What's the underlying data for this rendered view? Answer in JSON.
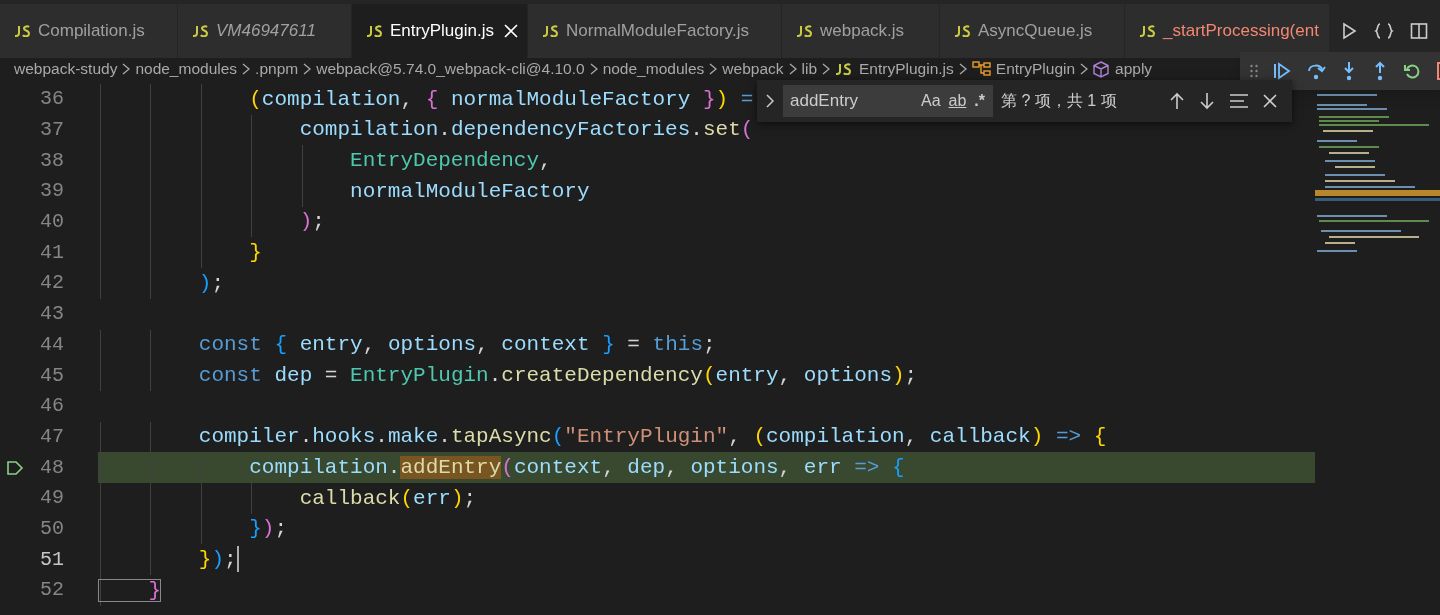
{
  "tabs": [
    {
      "label": "Compilation.js",
      "selected": false,
      "preview": false,
      "error": false
    },
    {
      "label": "VM46947611",
      "selected": false,
      "preview": true,
      "error": false
    },
    {
      "label": "EntryPlugin.js",
      "selected": true,
      "preview": false,
      "error": false
    },
    {
      "label": "NormalModuleFactory.js",
      "selected": false,
      "preview": false,
      "error": false
    },
    {
      "label": "webpack.js",
      "selected": false,
      "preview": false,
      "error": false
    },
    {
      "label": "AsyncQueue.js",
      "selected": false,
      "preview": false,
      "error": false
    },
    {
      "label": "_startProcessing(ent",
      "selected": false,
      "preview": false,
      "error": true
    }
  ],
  "breadcrumbs": [
    {
      "label": "webpack-study",
      "kind": "folder"
    },
    {
      "label": "node_modules",
      "kind": "folder"
    },
    {
      "label": ".pnpm",
      "kind": "folder"
    },
    {
      "label": "webpack@5.74.0_webpack-cli@4.10.0",
      "kind": "folder"
    },
    {
      "label": "node_modules",
      "kind": "folder"
    },
    {
      "label": "webpack",
      "kind": "folder"
    },
    {
      "label": "lib",
      "kind": "folder"
    },
    {
      "label": "EntryPlugin.js",
      "kind": "file"
    },
    {
      "label": "EntryPlugin",
      "kind": "class"
    },
    {
      "label": "apply",
      "kind": "method"
    }
  ],
  "find_widget": {
    "query": "addEntry",
    "options": [
      "Aa",
      "ab",
      ".*"
    ],
    "result": "第 ? 项，共 1 项"
  },
  "lines": [
    {
      "number": "36",
      "current": false,
      "paused": false,
      "tokens": [
        {
          "text": "            (",
          "kind": "b1"
        },
        {
          "text": "compilation",
          "kind": "var"
        },
        {
          "text": ", ",
          "kind": "punc"
        },
        {
          "text": "{",
          "kind": "b2"
        },
        {
          "text": " normalModuleFactory ",
          "kind": "var"
        },
        {
          "text": "}",
          "kind": "b2"
        },
        {
          "text": ")",
          "kind": "b1"
        },
        {
          "text": " =",
          "kind": "kw"
        }
      ]
    },
    {
      "number": "37",
      "current": false,
      "paused": false,
      "tokens": [
        {
          "text": "                compilation",
          "kind": "var"
        },
        {
          "text": ".",
          "kind": "punc"
        },
        {
          "text": "dependencyFactories",
          "kind": "var"
        },
        {
          "text": ".",
          "kind": "punc"
        },
        {
          "text": "set",
          "kind": "func"
        },
        {
          "text": "(",
          "kind": "b2"
        }
      ]
    },
    {
      "number": "38",
      "current": false,
      "paused": false,
      "tokens": [
        {
          "text": "                    EntryDependency",
          "kind": "cls"
        },
        {
          "text": ",",
          "kind": "punc"
        }
      ]
    },
    {
      "number": "39",
      "current": false,
      "paused": false,
      "tokens": [
        {
          "text": "                    normalModuleFactory",
          "kind": "var"
        }
      ]
    },
    {
      "number": "40",
      "current": false,
      "paused": false,
      "tokens": [
        {
          "text": "                )",
          "kind": "b2"
        },
        {
          "text": ";",
          "kind": "punc"
        }
      ]
    },
    {
      "number": "41",
      "current": false,
      "paused": false,
      "tokens": [
        {
          "text": "            }",
          "kind": "b1"
        }
      ]
    },
    {
      "number": "42",
      "current": false,
      "paused": false,
      "tokens": [
        {
          "text": "        )",
          "kind": "b3"
        },
        {
          "text": ";",
          "kind": "punc"
        }
      ]
    },
    {
      "number": "43",
      "current": false,
      "paused": false
    },
    {
      "number": "44",
      "current": false,
      "paused": false,
      "tokens": [
        {
          "text": "        const ",
          "kind": "kw"
        },
        {
          "text": "{",
          "kind": "b3"
        },
        {
          "text": " entry",
          "kind": "var"
        },
        {
          "text": ", ",
          "kind": "punc"
        },
        {
          "text": "options",
          "kind": "var"
        },
        {
          "text": ", ",
          "kind": "punc"
        },
        {
          "text": "context ",
          "kind": "var"
        },
        {
          "text": "}",
          "kind": "b3"
        },
        {
          "text": " = ",
          "kind": "punc"
        },
        {
          "text": "this",
          "kind": "kw"
        },
        {
          "text": ";",
          "kind": "punc"
        }
      ]
    },
    {
      "number": "45",
      "current": false,
      "paused": false,
      "tokens": [
        {
          "text": "        const ",
          "kind": "kw"
        },
        {
          "text": "dep",
          "kind": "var"
        },
        {
          "text": " = ",
          "kind": "punc"
        },
        {
          "text": "EntryPlugin",
          "kind": "cls"
        },
        {
          "text": ".",
          "kind": "punc"
        },
        {
          "text": "createDependency",
          "kind": "func"
        },
        {
          "text": "(",
          "kind": "b1"
        },
        {
          "text": "entry",
          "kind": "var"
        },
        {
          "text": ", ",
          "kind": "punc"
        },
        {
          "text": "options",
          "kind": "var"
        },
        {
          "text": ")",
          "kind": "b1"
        },
        {
          "text": ";",
          "kind": "punc"
        }
      ]
    },
    {
      "number": "46",
      "current": false,
      "paused": false
    },
    {
      "number": "47",
      "current": false,
      "paused": false,
      "tokens": [
        {
          "text": "        compiler",
          "kind": "var"
        },
        {
          "text": ".",
          "kind": "punc"
        },
        {
          "text": "hooks",
          "kind": "var"
        },
        {
          "text": ".",
          "kind": "punc"
        },
        {
          "text": "make",
          "kind": "var"
        },
        {
          "text": ".",
          "kind": "punc"
        },
        {
          "text": "tapAsync",
          "kind": "func"
        },
        {
          "text": "(",
          "kind": "b3"
        },
        {
          "text": "\"EntryPlugin\"",
          "kind": "str"
        },
        {
          "text": ", ",
          "kind": "punc"
        },
        {
          "text": "(",
          "kind": "b1"
        },
        {
          "text": "compilation",
          "kind": "var"
        },
        {
          "text": ", ",
          "kind": "punc"
        },
        {
          "text": "callback",
          "kind": "var"
        },
        {
          "text": ")",
          "kind": "b1"
        },
        {
          "text": " => ",
          "kind": "kw"
        },
        {
          "text": "{",
          "kind": "b1"
        }
      ]
    },
    {
      "number": "48",
      "current": false,
      "paused": true,
      "tokens": [
        {
          "text": "            compilation",
          "kind": "var"
        },
        {
          "text": ".",
          "kind": "punc"
        },
        {
          "text": "addEntry",
          "kind": "match"
        },
        {
          "text": "(",
          "kind": "b2"
        },
        {
          "text": "context",
          "kind": "var"
        },
        {
          "text": ", ",
          "kind": "punc"
        },
        {
          "text": "dep",
          "kind": "var"
        },
        {
          "text": ", ",
          "kind": "punc"
        },
        {
          "text": "options",
          "kind": "var"
        },
        {
          "text": ", ",
          "kind": "punc"
        },
        {
          "text": "err",
          "kind": "var"
        },
        {
          "text": " => ",
          "kind": "kw"
        },
        {
          "text": "{",
          "kind": "b3"
        }
      ]
    },
    {
      "number": "49",
      "current": false,
      "paused": false,
      "tokens": [
        {
          "text": "                callback",
          "kind": "func"
        },
        {
          "text": "(",
          "kind": "b1"
        },
        {
          "text": "err",
          "kind": "var"
        },
        {
          "text": ")",
          "kind": "b1"
        },
        {
          "text": ";",
          "kind": "punc"
        }
      ]
    },
    {
      "number": "50",
      "current": false,
      "paused": false,
      "tokens": [
        {
          "text": "            }",
          "kind": "b3"
        },
        {
          "text": ")",
          "kind": "b2"
        },
        {
          "text": ";",
          "kind": "punc"
        }
      ]
    },
    {
      "number": "51",
      "current": true,
      "paused": false,
      "tokens": [
        {
          "text": "        }",
          "kind": "b1"
        },
        {
          "text": ")",
          "kind": "b3"
        },
        {
          "text": ";",
          "kind": "punc"
        }
      ]
    },
    {
      "number": "52",
      "current": false,
      "paused": false,
      "tokens": [
        {
          "text": "    }",
          "kind": "b2_match"
        }
      ]
    }
  ]
}
